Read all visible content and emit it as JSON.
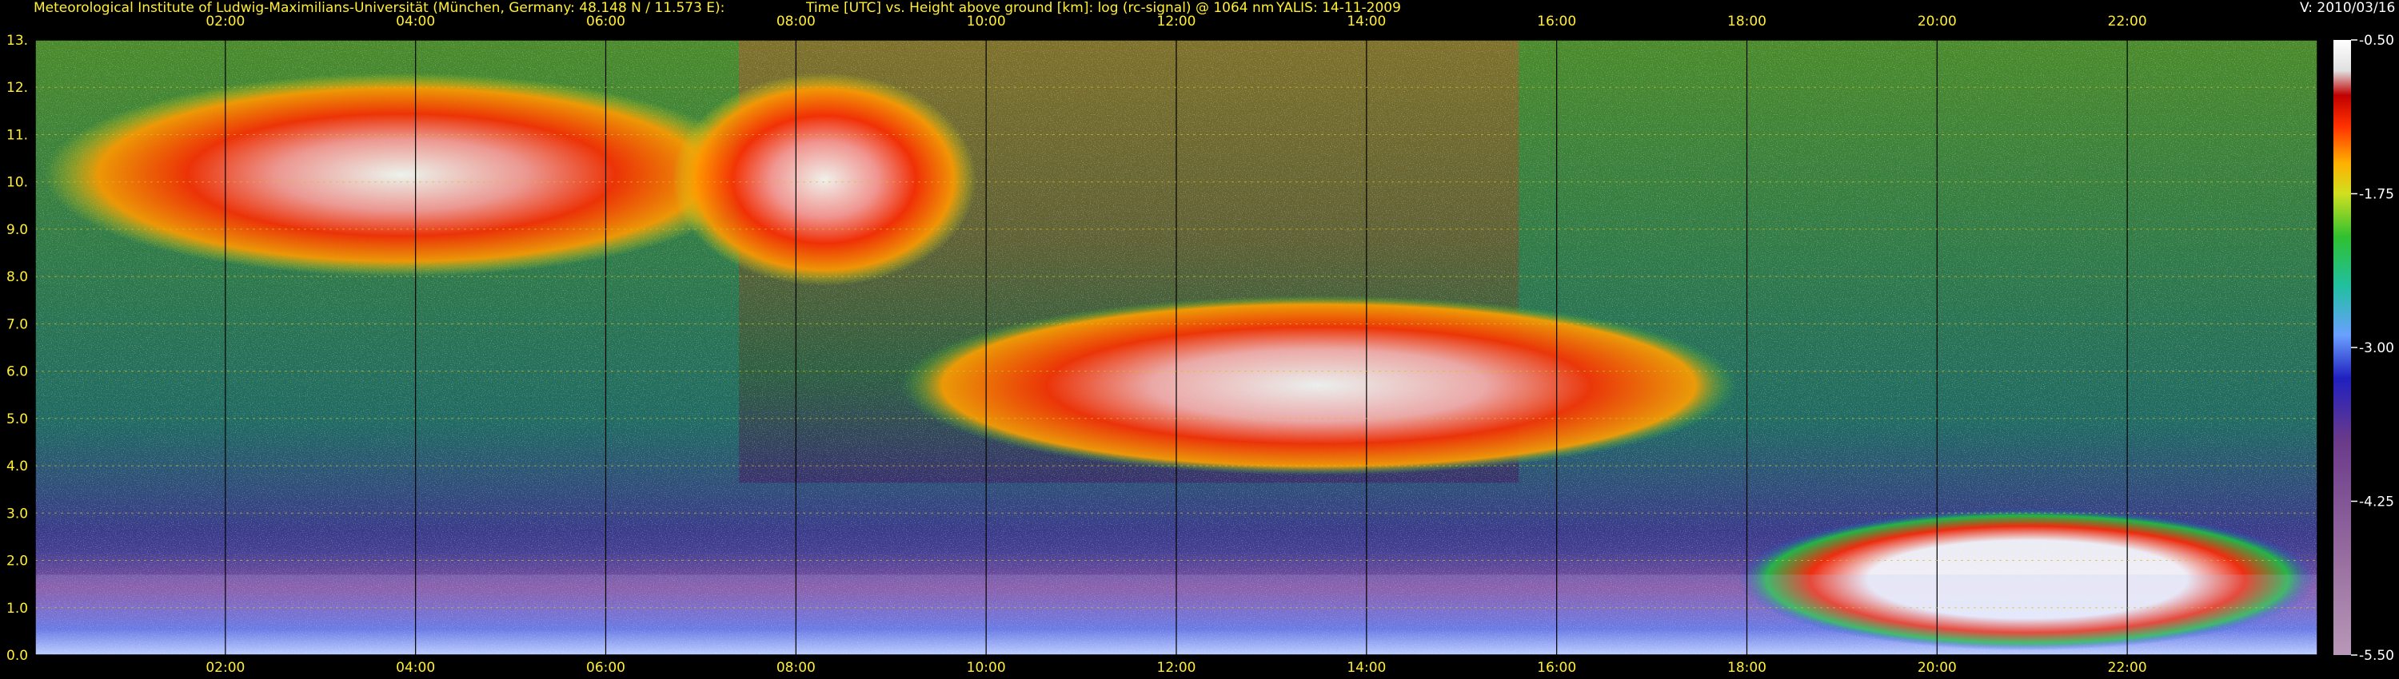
{
  "header": {
    "institute": "Meteorological Institute of Ludwig-Maximilians-Universität (München, Germany: 48.148 N / 11.573 E):",
    "title": "Time [UTC] vs. Height above ground [km]: log (rc-signal) @ 1064 nm",
    "instrument": "YALIS: 14-11-2009",
    "version": "V: 2010/03/16"
  },
  "chart_data": {
    "type": "heatmap",
    "x_ticks": [
      "02:00",
      "04:00",
      "06:00",
      "08:00",
      "10:00",
      "12:00",
      "14:00",
      "16:00",
      "18:00",
      "20:00",
      "22:00"
    ],
    "x_range_hours": [
      0,
      24
    ],
    "y_ticks": [
      "0.0",
      "1.0",
      "2.0",
      "3.0",
      "4.0",
      "5.0",
      "6.0",
      "7.0",
      "8.0",
      "9.0",
      "10.",
      "11.",
      "12.",
      "13."
    ],
    "y_range_km": [
      0,
      13
    ],
    "grid": true,
    "colorbar": {
      "range": [
        -5.5,
        -0.5
      ],
      "tick_labels": [
        "-0.50",
        "-1.75",
        "-3.00",
        "-4.25",
        "-5.50"
      ],
      "tick_values": [
        -0.5,
        -1.75,
        -3.0,
        -4.25,
        -5.5
      ]
    },
    "features": [
      {
        "kind": "cirrus",
        "t_start": 0.1,
        "t_end": 7.6,
        "z_bottom": 8.0,
        "z_top": 12.3
      },
      {
        "kind": "cirrus",
        "t_start": 6.7,
        "t_end": 9.9,
        "z_bottom": 7.8,
        "z_top": 12.3
      },
      {
        "kind": "mid-level cloud",
        "t_start": 9.1,
        "t_end": 17.9,
        "z_bottom": 3.8,
        "z_top": 7.6
      },
      {
        "kind": "low cloud",
        "t_start": 17.9,
        "t_end": 24.0,
        "z_bottom": 0.1,
        "z_top": 3.1
      },
      {
        "kind": "boundary layer",
        "t_start": 0.0,
        "t_end": 24.0,
        "z_bottom": 0.0,
        "z_top": 1.7
      }
    ]
  }
}
